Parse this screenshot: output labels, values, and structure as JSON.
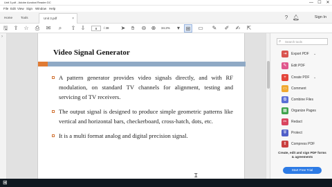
{
  "window": {
    "title": "Unit 3.pdf - Adobe Acrobat Reader DC",
    "controls": {
      "minimize": "—",
      "maximize": "☐",
      "close": "✕"
    }
  },
  "menu": {
    "items": [
      "File",
      "Edit",
      "View",
      "Sign",
      "Window",
      "Help"
    ]
  },
  "tabs": {
    "home": "Home",
    "tools": "Tools",
    "document": "Unit 3.pdf",
    "close": "×"
  },
  "header": {
    "sign_in": "Sign In"
  },
  "toolbar": {
    "page_current": "8",
    "page_total": "/ 38",
    "zoom": "34.2%"
  },
  "document": {
    "heading": "Video Signal Generator",
    "bullets": [
      "A pattern generator provides video signals directly, and with RF modulation, on standard TV channels for alignment, testing and servicing of TV receivers.",
      "The output signal is designed to produce simple geometric patterns like vertical and horizontal bars, checkerboard, cross-hatch, dots, etc.",
      "It is a multi format analog and digital precision signal."
    ]
  },
  "panel": {
    "search_placeholder": "Search tools",
    "tools": [
      {
        "label": "Export PDF",
        "icon": "export-pdf-icon",
        "color": "#d9534f",
        "chevron": "⌄"
      },
      {
        "label": "Edit PDF",
        "icon": "edit-pdf-icon",
        "color": "#e0578d"
      },
      {
        "label": "Create PDF",
        "icon": "create-pdf-icon",
        "color": "#e4463b",
        "chevron": "⌄"
      },
      {
        "label": "Comment",
        "icon": "comment-icon",
        "color": "#f0a830"
      },
      {
        "label": "Combine Files",
        "icon": "combine-files-icon",
        "color": "#5b6fd6"
      },
      {
        "label": "Organize Pages",
        "icon": "organize-pages-icon",
        "color": "#3fa34d"
      },
      {
        "label": "Redact",
        "icon": "redact-icon",
        "color": "#d9455f"
      },
      {
        "label": "Protect",
        "icon": "protect-icon",
        "color": "#4f5fc8"
      },
      {
        "label": "Compress PDF",
        "icon": "compress-pdf-icon",
        "color": "#c93f3f"
      }
    ],
    "promo": "Create, edit and sign PDF forms & agreements",
    "trial_button": "Start Free Trial"
  }
}
